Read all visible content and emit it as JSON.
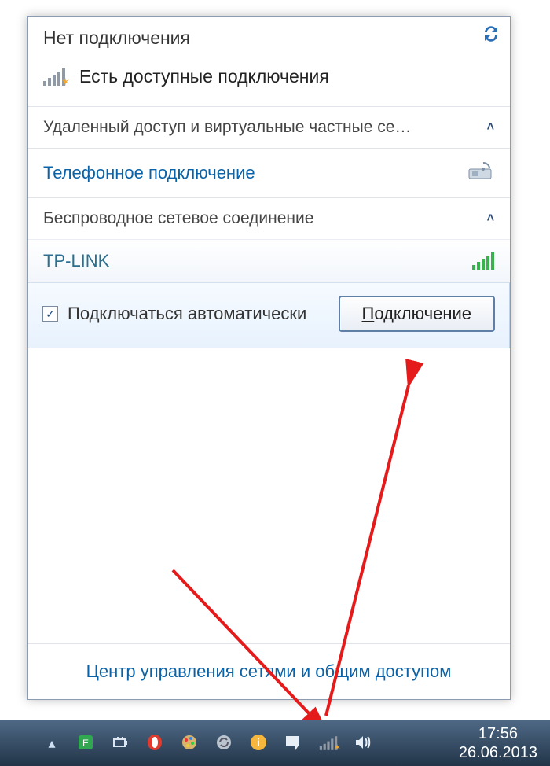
{
  "flyout": {
    "title": "Нет подключения",
    "available": "Есть доступные подключения",
    "section_dialup": "Удаленный доступ и виртуальные частные се…",
    "item_phone": "Телефонное подключение",
    "section_wifi": "Беспроводное сетевое соединение",
    "network_name": "TP-LINK",
    "auto_connect": "Подключаться автоматически",
    "connect_btn": "Подключение",
    "footer_link": "Центр управления сетями и общим доступом"
  },
  "taskbar": {
    "time": "17:56",
    "date": "26.06.2013"
  }
}
